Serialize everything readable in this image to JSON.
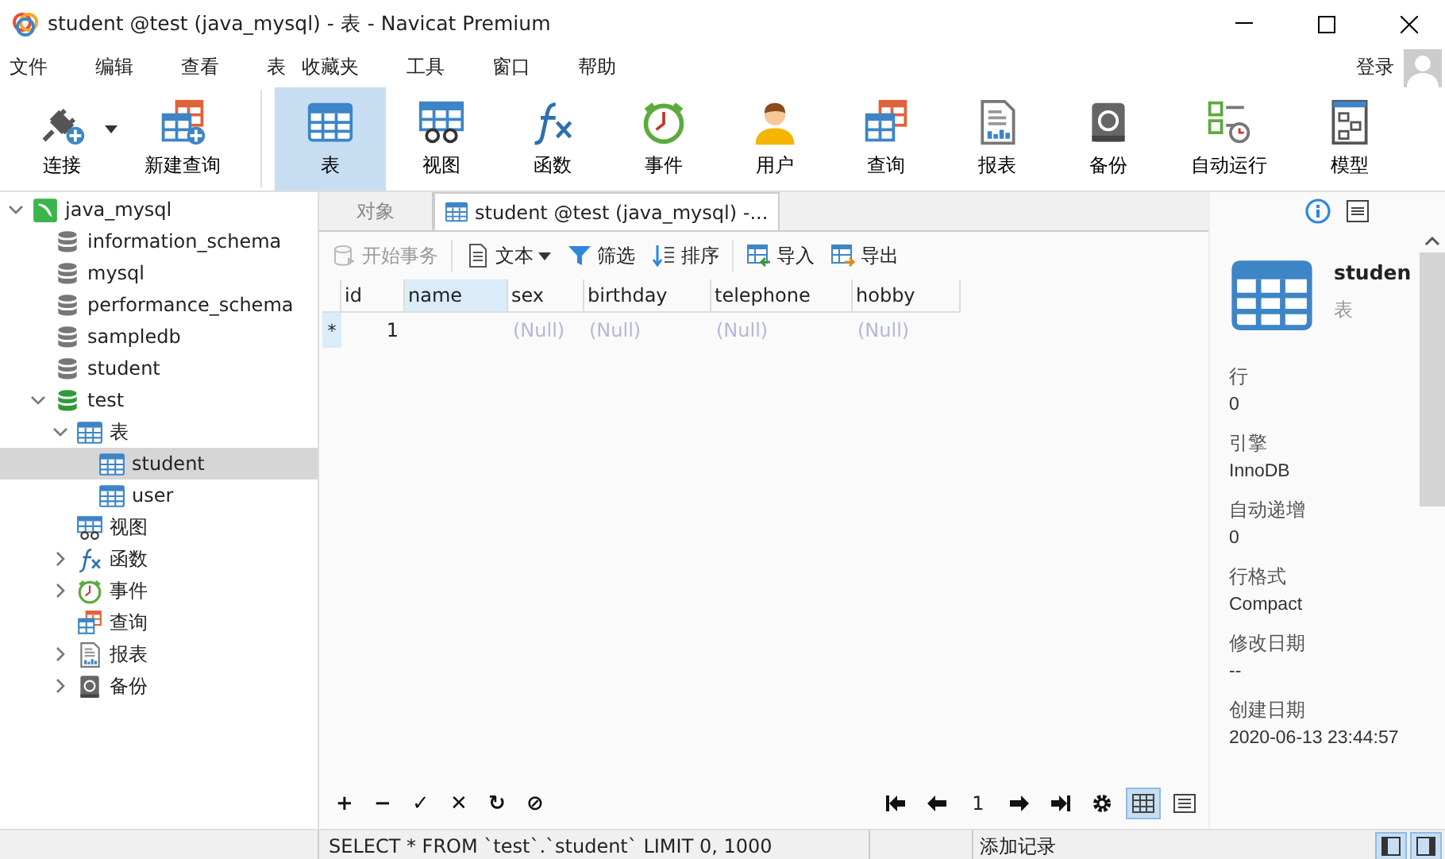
{
  "window": {
    "title": "student @test (java_mysql) - 表 - Navicat Premium"
  },
  "menu": [
    "文件",
    "编辑",
    "查看",
    "表",
    "收藏夹",
    "工具",
    "窗口",
    "帮助"
  ],
  "login": "登录",
  "toolbar": [
    {
      "label": "连接",
      "selected": false,
      "dropdown": true
    },
    {
      "label": "新建查询",
      "selected": false,
      "dropdown": false
    },
    {
      "label": "表",
      "selected": true,
      "dropdown": false
    },
    {
      "label": "视图",
      "selected": false,
      "dropdown": false
    },
    {
      "label": "函数",
      "selected": false,
      "dropdown": false
    },
    {
      "label": "事件",
      "selected": false,
      "dropdown": false
    },
    {
      "label": "用户",
      "selected": false,
      "dropdown": false
    },
    {
      "label": "查询",
      "selected": false,
      "dropdown": false
    },
    {
      "label": "报表",
      "selected": false,
      "dropdown": false
    },
    {
      "label": "备份",
      "selected": false,
      "dropdown": false
    },
    {
      "label": "自动运行",
      "selected": false,
      "dropdown": false
    },
    {
      "label": "模型",
      "selected": false,
      "dropdown": false
    }
  ],
  "tree": [
    {
      "label": "java_mysql",
      "kind": "connection",
      "expanded": true,
      "selected": false,
      "children": [
        {
          "label": "information_schema",
          "kind": "database",
          "selected": false
        },
        {
          "label": "mysql",
          "kind": "database",
          "selected": false
        },
        {
          "label": "performance_schema",
          "kind": "database",
          "selected": false
        },
        {
          "label": "sampledb",
          "kind": "database",
          "selected": false
        },
        {
          "label": "student",
          "kind": "database",
          "selected": false
        },
        {
          "label": "test",
          "kind": "open-database",
          "expanded": true,
          "selected": false,
          "children": [
            {
              "label": "表",
              "kind": "tables",
              "expanded": true,
              "selected": false,
              "children": [
                {
                  "label": "student",
                  "kind": "table",
                  "selected": true
                },
                {
                  "label": "user",
                  "kind": "table",
                  "selected": false
                }
              ]
            },
            {
              "label": "视图",
              "kind": "views",
              "selected": false
            },
            {
              "label": "函数",
              "kind": "functions",
              "expanded": false,
              "selected": false
            },
            {
              "label": "事件",
              "kind": "events",
              "expanded": false,
              "selected": false
            },
            {
              "label": "查询",
              "kind": "queries",
              "selected": false
            },
            {
              "label": "报表",
              "kind": "reports",
              "expanded": false,
              "selected": false
            },
            {
              "label": "备份",
              "kind": "backups",
              "expanded": false,
              "selected": false
            }
          ]
        }
      ]
    }
  ],
  "tabs": [
    {
      "label": "对象",
      "selected": false
    },
    {
      "label": "student @test (java_mysql) -...",
      "selected": true
    }
  ],
  "actions": [
    {
      "label": "开始事务",
      "disabled": true,
      "dropdown": false
    },
    {
      "label": "文本",
      "disabled": false,
      "dropdown": true
    },
    {
      "label": "筛选",
      "disabled": false,
      "dropdown": false
    },
    {
      "label": "排序",
      "disabled": false,
      "dropdown": false
    },
    {
      "label": "导入",
      "disabled": false,
      "dropdown": false
    },
    {
      "label": "导出",
      "disabled": false,
      "dropdown": false
    }
  ],
  "table": {
    "columns": [
      {
        "label": "id",
        "selected": false
      },
      {
        "label": "name",
        "selected": true
      },
      {
        "label": "sex",
        "selected": false
      },
      {
        "label": "birthday",
        "selected": false
      },
      {
        "label": "telephone",
        "selected": false
      },
      {
        "label": "hobby",
        "selected": false
      }
    ],
    "rows": [
      {
        "marker": "*",
        "cells": [
          {
            "kind": "number",
            "value": "1"
          },
          {
            "kind": "empty"
          },
          {
            "kind": "null",
            "value": "(Null)"
          },
          {
            "kind": "null",
            "value": "(Null)"
          },
          {
            "kind": "null",
            "value": "(Null)"
          },
          {
            "kind": "null",
            "value": "(Null)"
          }
        ]
      }
    ]
  },
  "record_buttons": [
    "+",
    "−",
    "✓",
    "✕",
    "↻",
    "⊘"
  ],
  "pager": {
    "page": "1"
  },
  "views": [
    {
      "kind": "grid",
      "selected": true
    },
    {
      "kind": "form",
      "selected": false
    }
  ],
  "info": {
    "name": "studen",
    "type": "表",
    "properties": [
      {
        "label": "行",
        "value": "0"
      },
      {
        "label": "引擎",
        "value": "InnoDB"
      },
      {
        "label": "自动递增",
        "value": "0"
      },
      {
        "label": "行格式",
        "value": "Compact"
      },
      {
        "label": "修改日期",
        "value": "--"
      },
      {
        "label": "创建日期",
        "value": "2020-06-13 23:44:57"
      }
    ]
  },
  "status_bar": {
    "sql": "SELECT * FROM `test`.`student` LIMIT 0, 1000",
    "message": "添加记录"
  }
}
